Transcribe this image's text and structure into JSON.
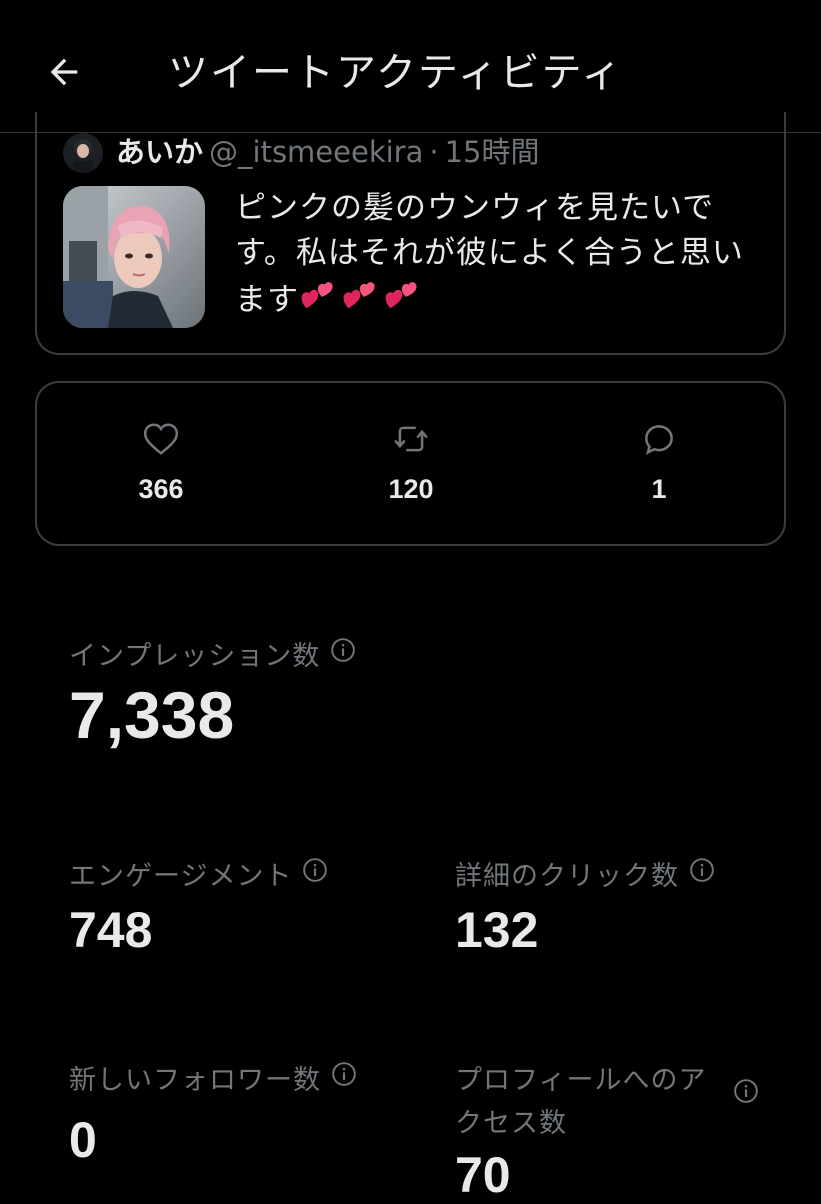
{
  "header": {
    "title": "ツイートアクティビティ",
    "back_icon": "arrow-left-icon"
  },
  "tweet": {
    "author_name": "あいか",
    "author_handle": "@_itsmeeekira",
    "separator": "·",
    "time": "15時間",
    "text_line1": "ピンクの髪のウンウィを見たいで",
    "text_line2": "す。私はそれが彼によく合うと思い",
    "text_line3": "ます",
    "emoji": "two-hearts-icon"
  },
  "engagement": {
    "likes": "366",
    "retweets": "120",
    "replies": "1"
  },
  "metrics": {
    "impressions_label": "インプレッション数",
    "impressions_value": "7,338",
    "engagements_label": "エンゲージメント",
    "engagements_value": "748",
    "detail_clicks_label": "詳細のクリック数",
    "detail_clicks_value": "132",
    "new_followers_label": "新しいフォロワー数",
    "new_followers_value": "0",
    "profile_visits_label_line1": "プロフィールへのア",
    "profile_visits_label_line2": "クセス数",
    "profile_visits_value": "70"
  },
  "colors": {
    "background": "#000000",
    "text_primary": "#e7e9ea",
    "text_secondary": "#71767b",
    "border": "#3a3d40",
    "heart_emoji": "#e0245e"
  }
}
